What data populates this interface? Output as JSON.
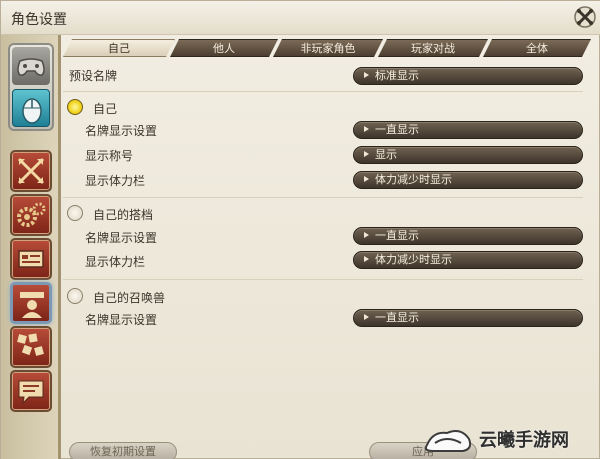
{
  "window": {
    "title": "角色设置"
  },
  "tabs": [
    {
      "label": "自己",
      "active": true
    },
    {
      "label": "他人",
      "active": false
    },
    {
      "label": "非玩家角色",
      "active": false
    },
    {
      "label": "玩家对战",
      "active": false
    },
    {
      "label": "全体",
      "active": false
    }
  ],
  "preset": {
    "label": "预设名牌",
    "value": "标准显示"
  },
  "sections": [
    {
      "title": "自己",
      "selected": true,
      "rows": [
        {
          "label": "名牌显示设置",
          "value": "一直显示"
        },
        {
          "label": "显示称号",
          "value": "显示"
        },
        {
          "label": "显示体力栏",
          "value": "体力减少时显示"
        }
      ]
    },
    {
      "title": "自己的搭档",
      "selected": false,
      "rows": [
        {
          "label": "名牌显示设置",
          "value": "一直显示"
        },
        {
          "label": "显示体力栏",
          "value": "体力减少时显示"
        }
      ]
    },
    {
      "title": "自己的召唤兽",
      "selected": false,
      "rows": [
        {
          "label": "名牌显示设置",
          "value": "一直显示"
        }
      ]
    }
  ],
  "footer": {
    "reset_label": "恢复初期设置",
    "apply_label": "应用"
  },
  "watermark": {
    "text": "云曦手游网"
  },
  "icons": {
    "sidebar": [
      "gamepad-icon",
      "mouse-icon",
      "crossed-arrows-icon",
      "gears-icon",
      "hotbar-icon",
      "nameplate-icon",
      "dice-grid-icon",
      "chat-bubble-icon"
    ],
    "close": "close-icon"
  }
}
